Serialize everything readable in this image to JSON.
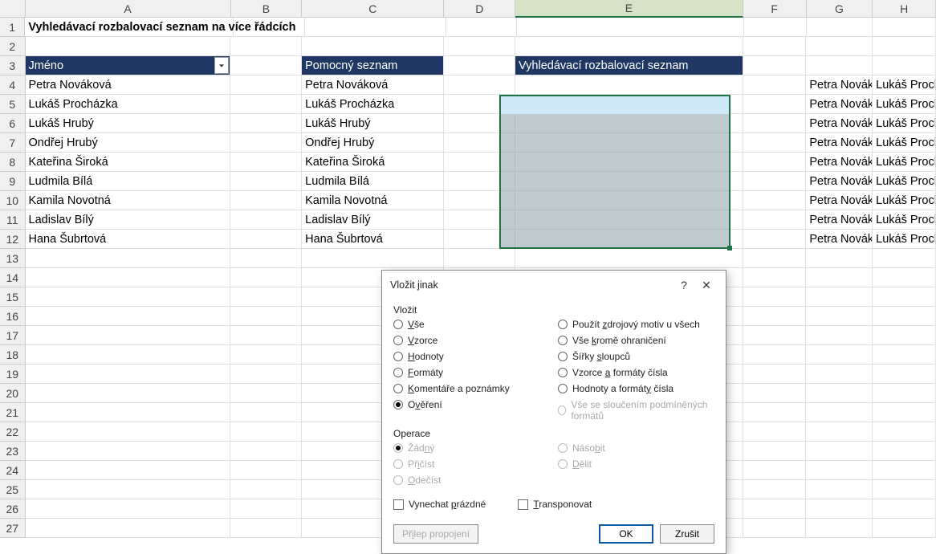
{
  "columns": [
    "A",
    "B",
    "C",
    "D",
    "E",
    "F",
    "G",
    "H"
  ],
  "rowCount": 27,
  "title": "Vyhledávací rozbalovací seznam na více řádcích",
  "headers": {
    "a3": "Jméno",
    "c3": "Pomocný seznam",
    "e3": "Vyhledávací rozbalovací seznam"
  },
  "names": [
    "Petra Nováková",
    "Lukáš Procházka",
    "Lukáš Hrubý",
    "Ondřej Hrubý",
    "Kateřina Široká",
    "Ludmila Bílá",
    "Kamila Novotná",
    "Ladislav Bílý",
    "Hana Šubrtová"
  ],
  "overflow": {
    "g": "Petra Novák",
    "h": "Lukáš Proch"
  },
  "dialog": {
    "title": "Vložit jinak",
    "section_paste": "Vložit",
    "left": [
      {
        "k": "vse",
        "label": "Vše",
        "u": [
          0,
          1
        ]
      },
      {
        "k": "vzorce",
        "label": "Vzorce",
        "u": [
          0,
          1
        ]
      },
      {
        "k": "hodnoty",
        "label": "Hodnoty",
        "u": [
          0,
          1
        ]
      },
      {
        "k": "formaty",
        "label": "Formáty",
        "u": [
          0,
          1
        ]
      },
      {
        "k": "komentare",
        "label": "Komentáře a poznámky",
        "u": [
          0,
          1
        ]
      },
      {
        "k": "overeni",
        "label": "Ověření",
        "u": [
          1,
          2
        ],
        "selected": true
      }
    ],
    "right": [
      {
        "k": "motiv",
        "label": "Použít zdrojový motiv u všech",
        "u": [
          7,
          8
        ]
      },
      {
        "k": "krome",
        "label": "Vše kromě ohraničení",
        "u": [
          4,
          5
        ]
      },
      {
        "k": "sirky",
        "label": "Šířky sloupců",
        "u": [
          6,
          7
        ]
      },
      {
        "k": "vzfmt",
        "label": "Vzorce a formáty čísla",
        "u": [
          7,
          8
        ]
      },
      {
        "k": "hdfmt",
        "label": "Hodnoty a formáty čísla",
        "u": [
          16,
          17
        ]
      },
      {
        "k": "slouc",
        "label": "Vše se sloučením podmíněných formátů",
        "disabled": true
      }
    ],
    "section_ops": "Operace",
    "ops_left": [
      {
        "k": "zadny",
        "label": "Žádný",
        "u": [
          3,
          4
        ],
        "selected": true,
        "disabled": true
      },
      {
        "k": "pricist",
        "label": "Přičíst",
        "u": [
          2,
          3
        ],
        "disabled": true
      },
      {
        "k": "odecist",
        "label": "Odečíst",
        "u": [
          0,
          1
        ],
        "disabled": true
      }
    ],
    "ops_right": [
      {
        "k": "nasobit",
        "label": "Násobit",
        "u": [
          4,
          5
        ],
        "disabled": true
      },
      {
        "k": "delit",
        "label": "Dělit",
        "u": [
          0,
          1
        ],
        "disabled": true
      }
    ],
    "chk_skip": "Vynechat prázdné",
    "chk_skip_u": [
      9,
      10
    ],
    "chk_trans": "Transponovat",
    "chk_trans_u": [
      0,
      1
    ],
    "btn_link": "Přilep propojení",
    "btn_link_u": [
      2,
      3
    ],
    "btn_ok": "OK",
    "btn_cancel": "Zrušit"
  }
}
